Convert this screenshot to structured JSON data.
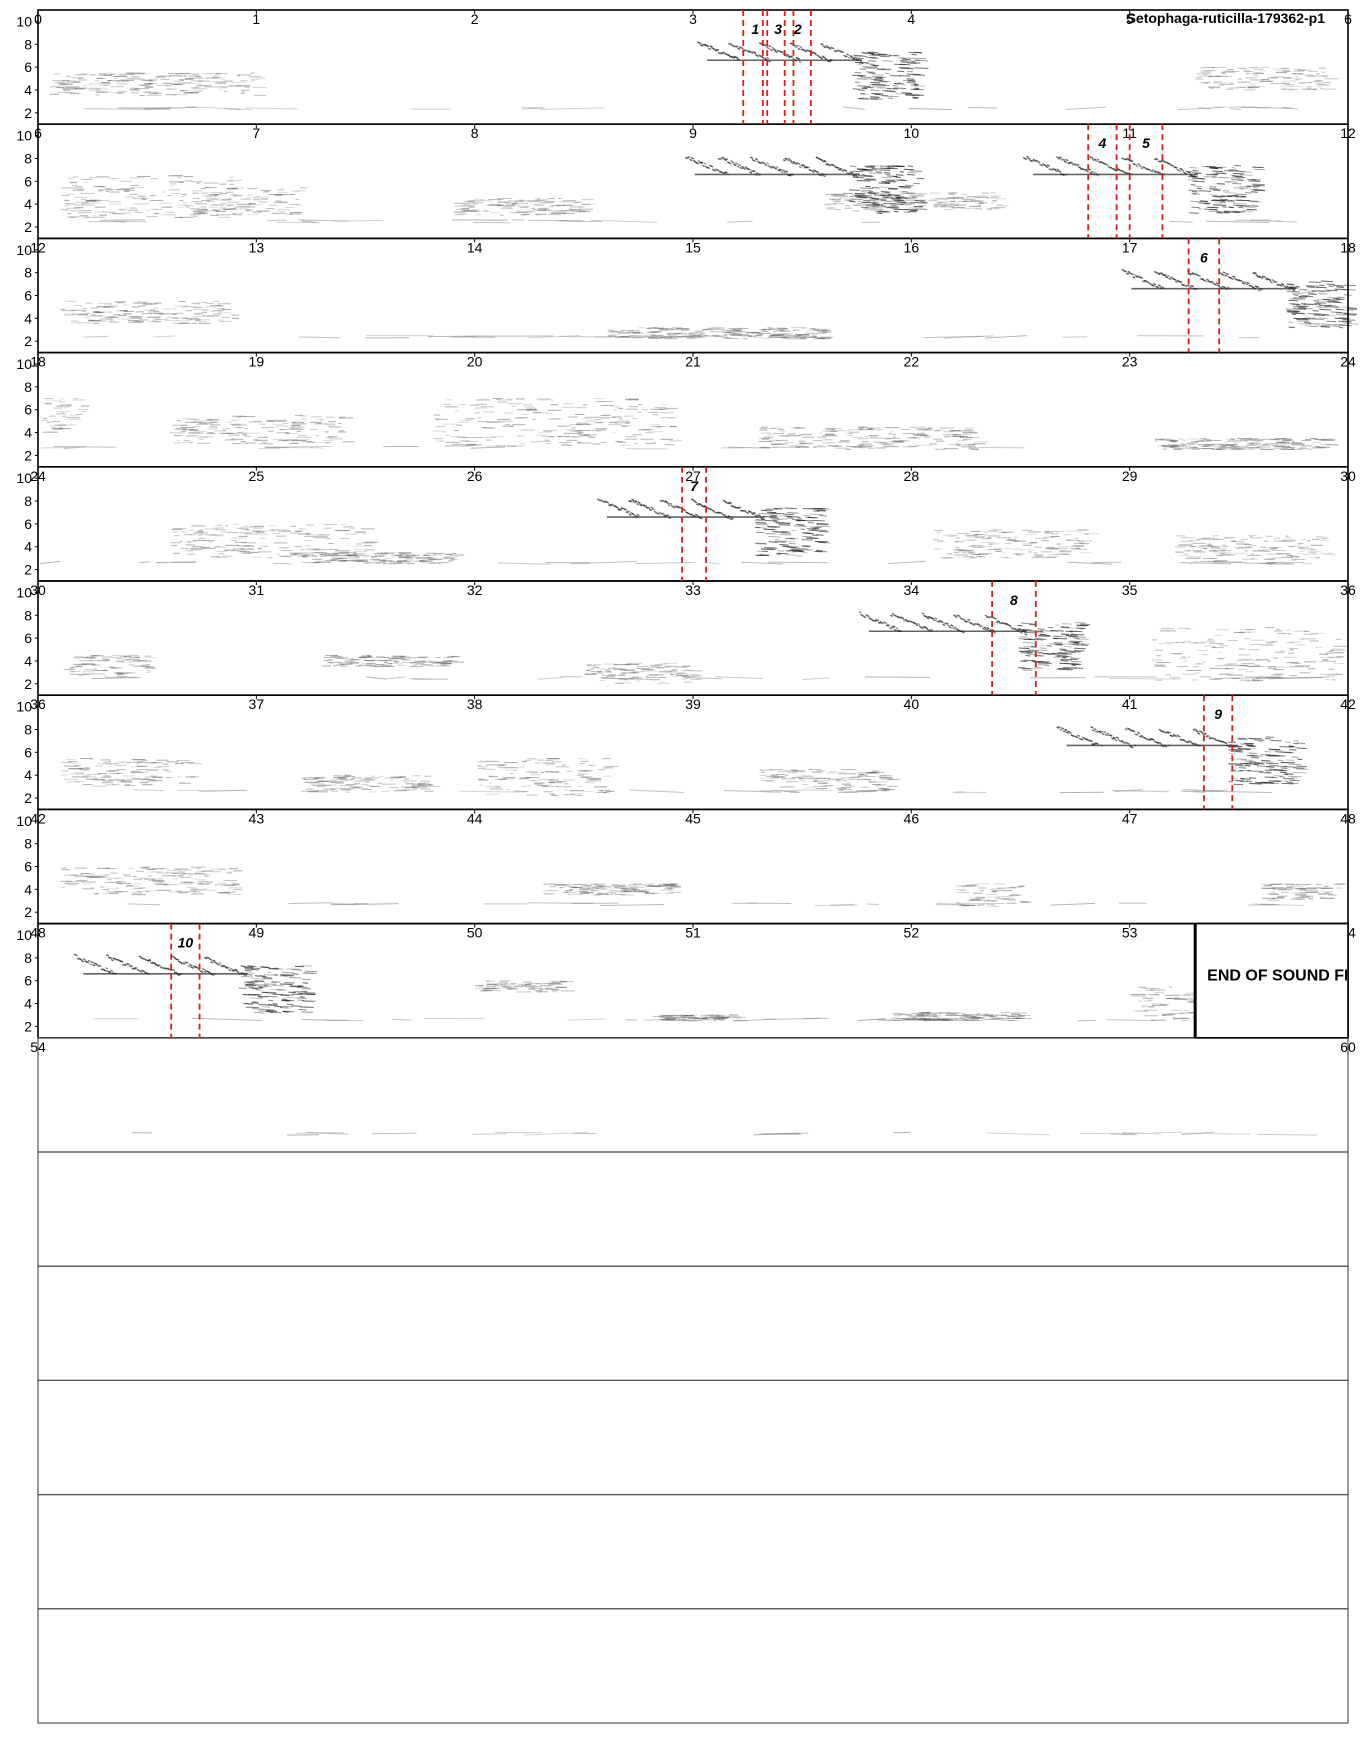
{
  "title": "Setophaga-ruticilla-179362-p1",
  "end_label": "END OF SOUND FILE",
  "chart_data": {
    "type": "spectrogram",
    "title": "Setophaga-ruticilla-179362-p1",
    "rows": 15,
    "seconds_per_row": 6,
    "ylim": [
      1,
      11
    ],
    "yticks": [
      2,
      4,
      6,
      8,
      10
    ],
    "file_end_seconds": 53.3,
    "colors": {
      "border": "#000000",
      "marker": "#e21b1b",
      "ink": "#222222"
    },
    "markers": [
      {
        "label": "1",
        "start": 3.23,
        "end": 3.34
      },
      {
        "label": "2",
        "start": 3.42,
        "end": 3.54
      },
      {
        "label": "3",
        "start": 3.32,
        "end": 3.46
      },
      {
        "label": "4",
        "start": 10.81,
        "end": 10.94
      },
      {
        "label": "5",
        "start": 11.0,
        "end": 11.15
      },
      {
        "label": "6",
        "start": 17.27,
        "end": 17.41
      },
      {
        "label": "7",
        "start": 26.95,
        "end": 27.06
      },
      {
        "label": "8",
        "start": 34.37,
        "end": 34.57
      },
      {
        "label": "9",
        "start": 41.34,
        "end": 41.47
      },
      {
        "label": "10",
        "start": 48.61,
        "end": 48.74
      }
    ],
    "songs": [
      {
        "start": 2.96,
        "end": 4.14
      },
      {
        "start": 8.9,
        "end": 10.15
      },
      {
        "start": 10.45,
        "end": 11.7
      },
      {
        "start": 16.9,
        "end": 18.15
      },
      {
        "start": 26.5,
        "end": 27.7
      },
      {
        "start": 33.7,
        "end": 34.9
      },
      {
        "start": 40.6,
        "end": 41.9
      },
      {
        "start": 48.1,
        "end": 49.35
      }
    ],
    "noise": [
      {
        "start": 0.05,
        "end": 1.0,
        "fmin": 3.5,
        "fmax": 5.5
      },
      {
        "start": 5.3,
        "end": 5.9,
        "fmin": 4.0,
        "fmax": 6.0
      },
      {
        "start": 6.1,
        "end": 6.9,
        "fmin": 2.8,
        "fmax": 6.5
      },
      {
        "start": 6.7,
        "end": 7.2,
        "fmin": 3.0,
        "fmax": 5.5
      },
      {
        "start": 7.9,
        "end": 8.5,
        "fmin": 3.0,
        "fmax": 4.5
      },
      {
        "start": 9.6,
        "end": 10.4,
        "fmin": 3.5,
        "fmax": 5.0
      },
      {
        "start": 12.1,
        "end": 12.9,
        "fmin": 3.5,
        "fmax": 5.5
      },
      {
        "start": 14.6,
        "end": 15.6,
        "fmin": 2.2,
        "fmax": 3.2
      },
      {
        "start": 18.0,
        "end": 18.2,
        "fmin": 4.0,
        "fmax": 7.0
      },
      {
        "start": 18.6,
        "end": 19.4,
        "fmin": 3.0,
        "fmax": 5.5
      },
      {
        "start": 19.8,
        "end": 20.9,
        "fmin": 2.8,
        "fmax": 7.0
      },
      {
        "start": 21.3,
        "end": 22.3,
        "fmin": 2.5,
        "fmax": 4.5
      },
      {
        "start": 23.1,
        "end": 23.9,
        "fmin": 2.5,
        "fmax": 3.5
      },
      {
        "start": 24.6,
        "end": 25.5,
        "fmin": 3.0,
        "fmax": 6.0
      },
      {
        "start": 25.2,
        "end": 25.9,
        "fmin": 2.5,
        "fmax": 3.5
      },
      {
        "start": 28.1,
        "end": 28.8,
        "fmin": 3.0,
        "fmax": 5.5
      },
      {
        "start": 29.2,
        "end": 29.9,
        "fmin": 2.5,
        "fmax": 5.0
      },
      {
        "start": 30.1,
        "end": 30.5,
        "fmin": 2.5,
        "fmax": 4.5
      },
      {
        "start": 31.3,
        "end": 31.9,
        "fmin": 3.5,
        "fmax": 4.5
      },
      {
        "start": 32.5,
        "end": 33.0,
        "fmin": 2.0,
        "fmax": 3.8
      },
      {
        "start": 35.1,
        "end": 35.95,
        "fmin": 2.2,
        "fmax": 7.0
      },
      {
        "start": 36.1,
        "end": 36.7,
        "fmin": 3.0,
        "fmax": 5.5
      },
      {
        "start": 37.2,
        "end": 37.8,
        "fmin": 2.5,
        "fmax": 4.0
      },
      {
        "start": 38.0,
        "end": 38.6,
        "fmin": 2.2,
        "fmax": 5.5
      },
      {
        "start": 39.3,
        "end": 39.9,
        "fmin": 2.5,
        "fmax": 4.5
      },
      {
        "start": 42.1,
        "end": 42.9,
        "fmin": 3.5,
        "fmax": 6.0
      },
      {
        "start": 44.3,
        "end": 44.9,
        "fmin": 3.5,
        "fmax": 4.5
      },
      {
        "start": 46.2,
        "end": 46.5,
        "fmin": 2.5,
        "fmax": 4.5
      },
      {
        "start": 47.6,
        "end": 47.95,
        "fmin": 3.0,
        "fmax": 4.5
      },
      {
        "start": 50.0,
        "end": 50.4,
        "fmin": 5.0,
        "fmax": 6.0
      },
      {
        "start": 50.8,
        "end": 51.2,
        "fmin": 2.5,
        "fmax": 3.0
      },
      {
        "start": 51.9,
        "end": 52.5,
        "fmin": 2.5,
        "fmax": 3.2
      },
      {
        "start": 53.0,
        "end": 53.3,
        "fmin": 2.5,
        "fmax": 5.5
      }
    ],
    "hum_bands": [
      {
        "row": 0,
        "freq": 2.4
      },
      {
        "row": 1,
        "freq": 2.5
      },
      {
        "row": 2,
        "freq": 2.4
      },
      {
        "row": 3,
        "freq": 2.7
      },
      {
        "row": 4,
        "freq": 2.6
      },
      {
        "row": 5,
        "freq": 2.5
      },
      {
        "row": 6,
        "freq": 2.6
      },
      {
        "row": 7,
        "freq": 2.7
      },
      {
        "row": 8,
        "freq": 2.6
      },
      {
        "row": 9,
        "freq": 2.6
      }
    ]
  }
}
